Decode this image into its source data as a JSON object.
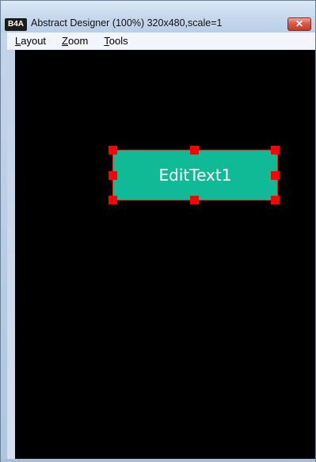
{
  "window": {
    "icon_text": "B4A",
    "title": "Abstract Designer (100%) 320x480,scale=1",
    "close_glyph": "✕",
    "close_icon": "close-icon"
  },
  "menu": {
    "items": [
      {
        "accel": "L",
        "rest": "ayout"
      },
      {
        "accel": "Z",
        "rest": "oom"
      },
      {
        "accel": "T",
        "rest": "ools"
      }
    ]
  },
  "designer": {
    "background": "#000000",
    "view": {
      "label": "EditText1",
      "fill_color": "#11ba96",
      "handle_color": "#ff0000"
    }
  }
}
